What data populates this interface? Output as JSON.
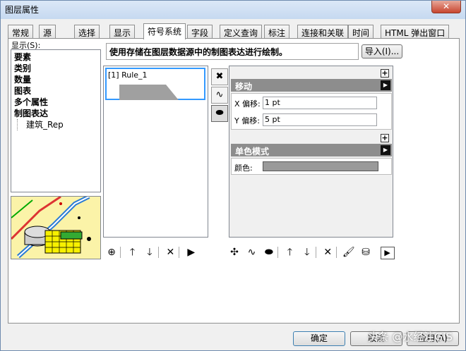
{
  "window": {
    "title": "图层属性",
    "close": "✕"
  },
  "tabs": [
    "常规",
    "源",
    "选择",
    "显示",
    "符号系统",
    "字段",
    "定义查询",
    "标注",
    "连接和关联",
    "时间",
    "HTML 弹出窗口"
  ],
  "active_tab": "符号系统",
  "show": {
    "label": "显示(S):",
    "items": [
      "要素",
      "类别",
      "数量",
      "图表",
      "多个属性",
      "制图表达"
    ],
    "sub_items": [
      "建筑_Rep"
    ]
  },
  "description": "使用存储在图层数据源中的制图表达进行绘制。",
  "import_button": "导入(I)...",
  "rules": [
    {
      "label": "[1] Rule_1"
    }
  ],
  "properties": {
    "move_section": {
      "title": "移动",
      "fields": [
        {
          "label": "X 偏移:",
          "value": "1 pt"
        },
        {
          "label": "Y 偏移:",
          "value": "5 pt"
        }
      ]
    },
    "color_section": {
      "title": "单色模式",
      "fields": [
        {
          "label": "颜色:",
          "swatch": "#9a9a9a"
        }
      ]
    }
  },
  "footer": {
    "ok": "确定",
    "cancel": "取消",
    "apply": "应用(A)"
  },
  "watermark": "头条 @水经注GIS"
}
